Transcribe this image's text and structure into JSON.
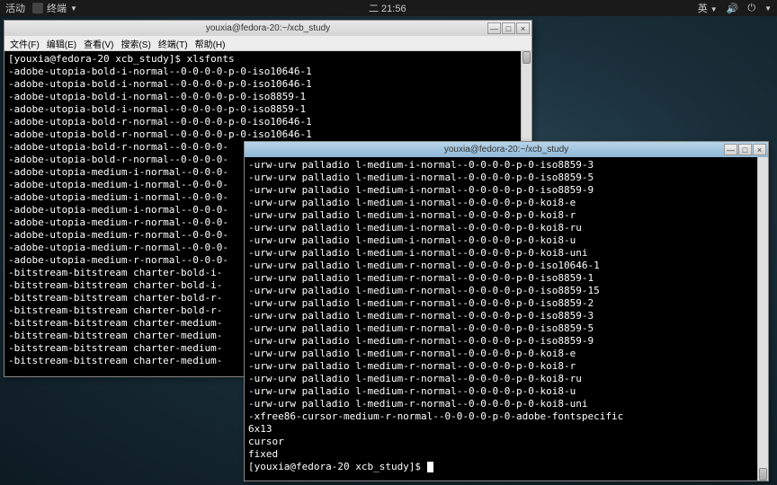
{
  "topbar": {
    "activities": "活动",
    "app": "终端",
    "clock": "二 21:56",
    "ime": "英"
  },
  "win1": {
    "title": "youxia@fedora-20:~/xcb_study",
    "menu": [
      "文件(F)",
      "编辑(E)",
      "查看(V)",
      "搜索(S)",
      "终端(T)",
      "帮助(H)"
    ],
    "prompt": "[youxia@fedora-20 xcb_study]$ ",
    "cmd": "xlsfonts",
    "lines": [
      "-adobe-utopia-bold-i-normal--0-0-0-0-p-0-iso10646-1",
      "-adobe-utopia-bold-i-normal--0-0-0-0-p-0-iso10646-1",
      "-adobe-utopia-bold-i-normal--0-0-0-0-p-0-iso8859-1",
      "-adobe-utopia-bold-i-normal--0-0-0-0-p-0-iso8859-1",
      "-adobe-utopia-bold-r-normal--0-0-0-0-p-0-iso10646-1",
      "-adobe-utopia-bold-r-normal--0-0-0-0-p-0-iso10646-1",
      "-adobe-utopia-bold-r-normal--0-0-0-0-",
      "-adobe-utopia-bold-r-normal--0-0-0-0-",
      "-adobe-utopia-medium-i-normal--0-0-0-",
      "-adobe-utopia-medium-i-normal--0-0-0-",
      "-adobe-utopia-medium-i-normal--0-0-0-",
      "-adobe-utopia-medium-i-normal--0-0-0-",
      "-adobe-utopia-medium-r-normal--0-0-0-",
      "-adobe-utopia-medium-r-normal--0-0-0-",
      "-adobe-utopia-medium-r-normal--0-0-0-",
      "-adobe-utopia-medium-r-normal--0-0-0-",
      "-bitstream-bitstream charter-bold-i-",
      "-bitstream-bitstream charter-bold-i-",
      "-bitstream-bitstream charter-bold-r-",
      "-bitstream-bitstream charter-bold-r-",
      "-bitstream-bitstream charter-medium-",
      "-bitstream-bitstream charter-medium-",
      "-bitstream-bitstream charter-medium-",
      "-bitstream-bitstream charter-medium-"
    ]
  },
  "win2": {
    "title": "youxia@fedora-20:~/xcb_study",
    "lines": [
      "-urw-urw palladio l-medium-i-normal--0-0-0-0-p-0-iso8859-3",
      "-urw-urw palladio l-medium-i-normal--0-0-0-0-p-0-iso8859-5",
      "-urw-urw palladio l-medium-i-normal--0-0-0-0-p-0-iso8859-9",
      "-urw-urw palladio l-medium-i-normal--0-0-0-0-p-0-koi8-e",
      "-urw-urw palladio l-medium-i-normal--0-0-0-0-p-0-koi8-r",
      "-urw-urw palladio l-medium-i-normal--0-0-0-0-p-0-koi8-ru",
      "-urw-urw palladio l-medium-i-normal--0-0-0-0-p-0-koi8-u",
      "-urw-urw palladio l-medium-i-normal--0-0-0-0-p-0-koi8-uni",
      "-urw-urw palladio l-medium-r-normal--0-0-0-0-p-0-iso10646-1",
      "-urw-urw palladio l-medium-r-normal--0-0-0-0-p-0-iso8859-1",
      "-urw-urw palladio l-medium-r-normal--0-0-0-0-p-0-iso8859-15",
      "-urw-urw palladio l-medium-r-normal--0-0-0-0-p-0-iso8859-2",
      "-urw-urw palladio l-medium-r-normal--0-0-0-0-p-0-iso8859-3",
      "-urw-urw palladio l-medium-r-normal--0-0-0-0-p-0-iso8859-5",
      "-urw-urw palladio l-medium-r-normal--0-0-0-0-p-0-iso8859-9",
      "-urw-urw palladio l-medium-r-normal--0-0-0-0-p-0-koi8-e",
      "-urw-urw palladio l-medium-r-normal--0-0-0-0-p-0-koi8-r",
      "-urw-urw palladio l-medium-r-normal--0-0-0-0-p-0-koi8-ru",
      "-urw-urw palladio l-medium-r-normal--0-0-0-0-p-0-koi8-u",
      "-urw-urw palladio l-medium-r-normal--0-0-0-0-p-0-koi8-uni",
      "-xfree86-cursor-medium-r-normal--0-0-0-0-p-0-adobe-fontspecific",
      "6x13",
      "cursor",
      "fixed"
    ],
    "prompt": "[youxia@fedora-20 xcb_study]$ "
  },
  "controls": {
    "min": "—",
    "max": "□",
    "close": "×"
  }
}
